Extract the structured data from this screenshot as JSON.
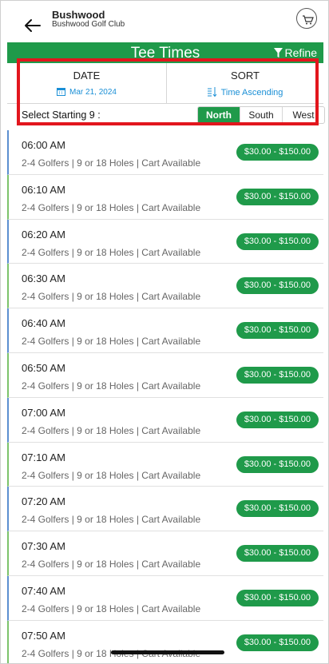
{
  "header": {
    "club_name": "Bushwood",
    "club_subtitle": "Bushwood Golf Club"
  },
  "page": {
    "title": "Tee Times",
    "refine_label": "Refine"
  },
  "filters": {
    "date_label": "DATE",
    "date_value": "Mar 21, 2024",
    "sort_label": "SORT",
    "sort_value": "Time Ascending",
    "start_label": "Select Starting 9 :",
    "nines": [
      "North",
      "South",
      "West"
    ],
    "active_nine": "North"
  },
  "tee_times": [
    {
      "time": "06:00 AM",
      "details": "2-4 Golfers | 9 or 18 Holes  | Cart Available",
      "price": "$30.00 - $150.00"
    },
    {
      "time": "06:10 AM",
      "details": "2-4 Golfers | 9 or 18 Holes  | Cart Available",
      "price": "$30.00 - $150.00"
    },
    {
      "time": "06:20 AM",
      "details": "2-4 Golfers | 9 or 18 Holes  | Cart Available",
      "price": "$30.00 - $150.00"
    },
    {
      "time": "06:30 AM",
      "details": "2-4 Golfers | 9 or 18 Holes  | Cart Available",
      "price": "$30.00 - $150.00"
    },
    {
      "time": "06:40 AM",
      "details": "2-4 Golfers | 9 or 18 Holes  | Cart Available",
      "price": "$30.00 - $150.00"
    },
    {
      "time": "06:50 AM",
      "details": "2-4 Golfers | 9 or 18 Holes  | Cart Available",
      "price": "$30.00 - $150.00"
    },
    {
      "time": "07:00 AM",
      "details": "2-4 Golfers | 9 or 18 Holes  | Cart Available",
      "price": "$30.00 - $150.00"
    },
    {
      "time": "07:10 AM",
      "details": "2-4 Golfers | 9 or 18 Holes  | Cart Available",
      "price": "$30.00 - $150.00"
    },
    {
      "time": "07:20 AM",
      "details": "2-4 Golfers | 9 or 18 Holes  | Cart Available",
      "price": "$30.00 - $150.00"
    },
    {
      "time": "07:30 AM",
      "details": "2-4 Golfers | 9 or 18 Holes  | Cart Available",
      "price": "$30.00 - $150.00"
    },
    {
      "time": "07:40 AM",
      "details": "2-4 Golfers | 9 or 18 Holes  | Cart Available",
      "price": "$30.00 - $150.00"
    },
    {
      "time": "07:50 AM",
      "details": "2-4 Golfers | 9 or 18 Holes  | Cart Available",
      "price": "$30.00 - $150.00"
    }
  ],
  "colors": {
    "brand_green": "#1f9a4a",
    "accent_blue": "#1a8fd6",
    "highlight_red": "#e2161d"
  }
}
